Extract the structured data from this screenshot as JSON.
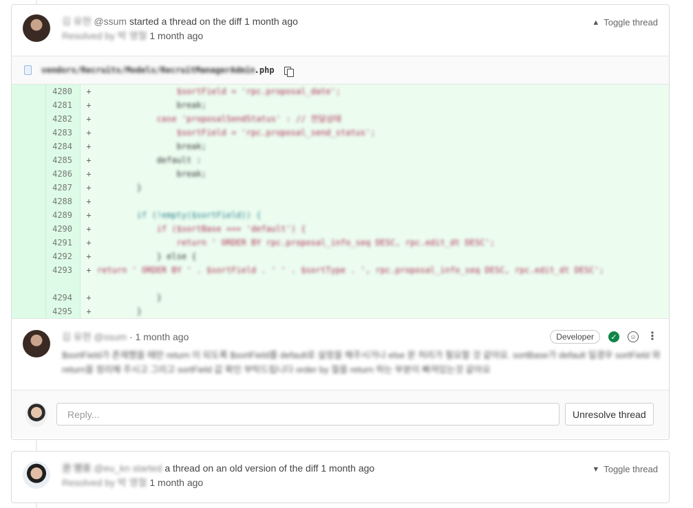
{
  "thread1": {
    "author_name": "김 유현",
    "author_handle": "@ssum",
    "started_text": "started a thread on the diff",
    "started_time": "1 month ago",
    "resolved_by": "Resolved by 박 영철",
    "resolved_time": "1 month ago",
    "toggle_label": "Toggle thread",
    "file": {
      "path_blurred": "vendors/Recruits/Models/RecruitManagerAdmin",
      "path_ext": ".php"
    },
    "diff_lines": [
      {
        "num": "4280",
        "sign": "+",
        "code": "                $sortField = 'rpc.proposal_date';"
      },
      {
        "num": "4281",
        "sign": "+",
        "code": "                break;"
      },
      {
        "num": "4282",
        "sign": "+",
        "code": "            case 'proposalSendStatus' : // 전달상태"
      },
      {
        "num": "4283",
        "sign": "+",
        "code": "                $sortField = 'rpc.proposal_send_status';"
      },
      {
        "num": "4284",
        "sign": "+",
        "code": "                break;"
      },
      {
        "num": "4285",
        "sign": "+",
        "code": "            default :"
      },
      {
        "num": "4286",
        "sign": "+",
        "code": "                break;"
      },
      {
        "num": "4287",
        "sign": "+",
        "code": "        }"
      },
      {
        "num": "4288",
        "sign": "+",
        "code": ""
      },
      {
        "num": "4289",
        "sign": "+",
        "code": "        if (!empty($sortField)) {"
      },
      {
        "num": "4290",
        "sign": "+",
        "code": "            if ($sortBase === 'default') {"
      },
      {
        "num": "4291",
        "sign": "+",
        "code": "                return ' ORDER BY rpc.proposal_info_seq DESC, rpc.edit_dt DESC';"
      },
      {
        "num": "4292",
        "sign": "+",
        "code": "            } else {"
      },
      {
        "num": "4293",
        "sign": "+",
        "code": "                return ' ORDER BY ' . $sortField . ' ' . $sortType . ', rpc.proposal_info_seq DESC, rpc.edit_dt DESC';"
      },
      {
        "num": "4294",
        "sign": "+",
        "code": "            }"
      },
      {
        "num": "4295",
        "sign": "+",
        "code": "        }"
      }
    ],
    "note": {
      "author_name": "김 유현",
      "author_handle": "@ssum",
      "time": "1 month ago",
      "role": "Developer",
      "body": "$sortField가 존재했을 때만 return 이 되도록 $sortField를 default로 설정을 해주시거나 else 문 처리가 필요할 것 같아요. sortBase가 default 일경우 sortField 와 return을 정리해 주시고 그리고 sortField 값 확인 부탁드립니다 order by 절을 return 하는 부분이 빠져있는것 같아요"
    },
    "reply_placeholder": "Reply...",
    "unresolve_label": "Unresolve thread"
  },
  "thread2": {
    "author_name": "권 영호",
    "author_handle": "@eu_kn started",
    "started_text": "a thread on an old version of the diff",
    "started_time": "1 month ago",
    "resolved_by": "Resolved by 박 영철",
    "resolved_time": "1 month ago",
    "toggle_label": "Toggle thread"
  }
}
